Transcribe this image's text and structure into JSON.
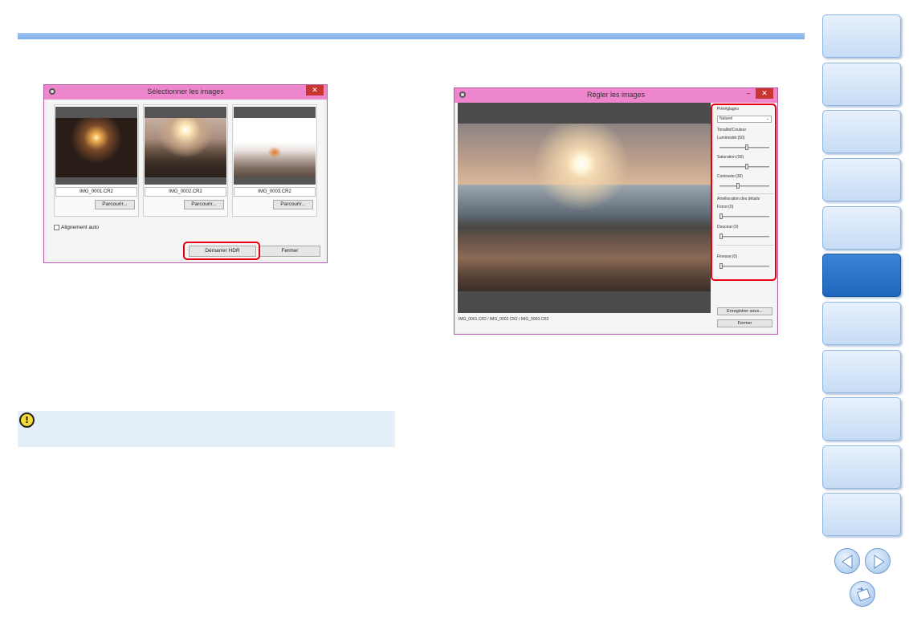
{
  "dialog1": {
    "title": "Sélectionner les images",
    "close_label": "✕",
    "images": [
      {
        "name": "IMG_0001.CR2",
        "browse_label": "Parcourir..."
      },
      {
        "name": "IMG_0002.CR2",
        "browse_label": "Parcourir..."
      },
      {
        "name": "IMG_0003.CR2",
        "browse_label": "Parcourir..."
      }
    ],
    "auto_align_label": "Alignement auto",
    "start_hdr_label": "Démarrer HDR",
    "close_button_label": "Fermer"
  },
  "dialog2": {
    "title": "Régler les images",
    "min_label": "–",
    "max_label": "▫",
    "close_label": "✕",
    "presets_label": "Préréglages",
    "preset_value": "Naturel",
    "tone_group": "Tonalité/Couleur",
    "brightness_label": "Luminosité:(50)",
    "saturation_label": "Saturation:(50)",
    "contrast_label": "Contraste:(30)",
    "detail_group": "Amélioration des détails",
    "strength_label": "Force:(0)",
    "smoothness_label": "Douceur:(0)",
    "fineness_label": "Finesse:(0)",
    "save_as_label": "Enregistrer sous...",
    "close_button_label": "Fermer",
    "status_text": "IMG_0001.CR2 / IMG_0002.CR2 / IMG_0003.CR2"
  },
  "caution": {
    "icon": "caution-icon"
  },
  "nav": {
    "tab_count": 11,
    "active_tab_index": 5,
    "prev_icon": "prev-arrow-icon",
    "next_icon": "next-arrow-icon",
    "return_icon": "return-icon"
  },
  "colors": {
    "title_bar": "#ee86cd",
    "highlight": "#e60012",
    "tab_active": "#1f66bd",
    "caution_bg": "#e5effa"
  }
}
